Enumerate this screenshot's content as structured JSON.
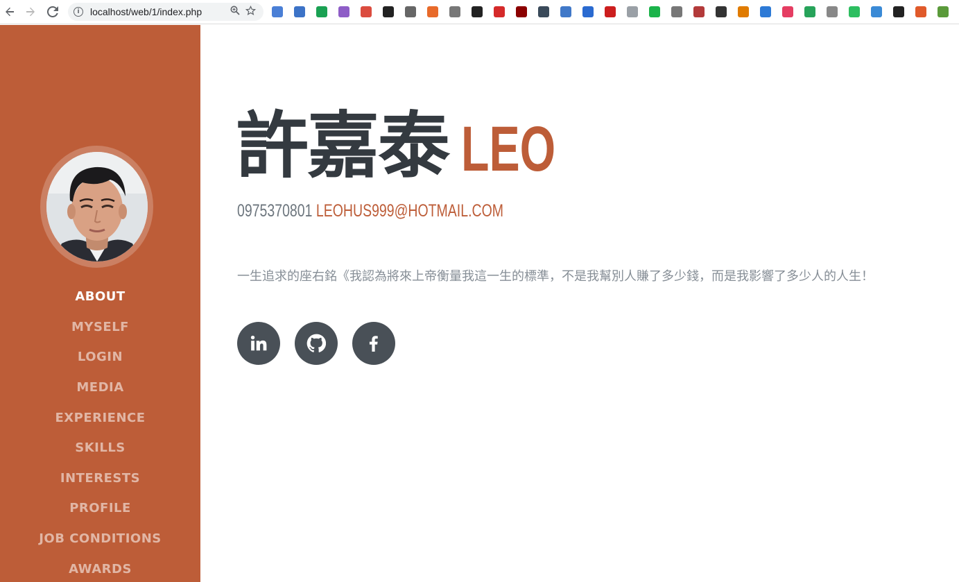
{
  "browser": {
    "url": "localhost/web/1/index.php",
    "extensions": [
      {
        "icon": "translate-icon",
        "color": "#4a7fd6"
      },
      {
        "icon": "mail-icon",
        "color": "#3c73c7"
      },
      {
        "icon": "d-badge-icon",
        "color": "#1aa153"
      },
      {
        "icon": "feather-icon",
        "color": "#8e5dc7"
      },
      {
        "icon": "todoist-icon",
        "color": "#db4c3f"
      },
      {
        "icon": "play-icon",
        "color": "#222222"
      },
      {
        "icon": "circle-icon",
        "color": "#666666"
      },
      {
        "icon": "music-icon",
        "color": "#e86a2a"
      },
      {
        "icon": "e-icon",
        "color": "#777777"
      },
      {
        "icon": "fish-icon",
        "color": "#222222"
      },
      {
        "icon": "hand-icon",
        "color": "#d52a2a"
      },
      {
        "icon": "ublock-icon",
        "color": "#8b0000"
      },
      {
        "icon": "e-dark-icon",
        "color": "#3a4a5a"
      },
      {
        "icon": "new-icon",
        "color": "#4078c8"
      },
      {
        "icon": "new-badge-icon",
        "color": "#2a6ad0"
      },
      {
        "icon": "adblock-icon",
        "color": "#cc1e1e"
      },
      {
        "icon": "dropbox-icon",
        "color": "#9aa0a6"
      },
      {
        "icon": "share-icon",
        "color": "#1bb34a"
      },
      {
        "icon": "chat-icon",
        "color": "#777777"
      },
      {
        "icon": "pdf-icon",
        "color": "#b33a3a"
      },
      {
        "icon": "brush-icon",
        "color": "#333333"
      },
      {
        "icon": "scissors-icon",
        "color": "#e07b00"
      },
      {
        "icon": "triangle-icon",
        "color": "#2d7ad6"
      },
      {
        "icon": "spiral-icon",
        "color": "#e53d62"
      },
      {
        "icon": "diamond-icon",
        "color": "#27a35a"
      },
      {
        "icon": "globe-icon",
        "color": "#888888"
      },
      {
        "icon": "evernote-icon",
        "color": "#2dbe60"
      },
      {
        "icon": "rainbow-icon",
        "color": "#3a8ad6"
      },
      {
        "icon": "ninja-icon",
        "color": "#222222"
      },
      {
        "icon": "lighthouse-icon",
        "color": "#e05a2a"
      },
      {
        "icon": "puzzle-icon",
        "color": "#5a9a3a"
      }
    ]
  },
  "sidebar": {
    "items": [
      {
        "label": "ABOUT",
        "active": true
      },
      {
        "label": "MYSELF",
        "active": false
      },
      {
        "label": "LOGIN",
        "active": false
      },
      {
        "label": "MEDIA",
        "active": false
      },
      {
        "label": "EXPERIENCE",
        "active": false
      },
      {
        "label": "SKILLS",
        "active": false
      },
      {
        "label": "INTERESTS",
        "active": false
      },
      {
        "label": "PROFILE",
        "active": false
      },
      {
        "label": "JOB CONDITIONS",
        "active": false
      },
      {
        "label": "AWARDS",
        "active": false
      }
    ]
  },
  "main": {
    "name_cn": "許嘉泰",
    "name_en": "LEO",
    "phone": "0975370801",
    "email": "LEOHUS999@HOTMAIL.COM",
    "motto": "一生追求的座右銘《我認為將來上帝衡量我這一生的標準，不是我幫別人賺了多少錢，而是我影響了多少人的人生！",
    "socials": [
      {
        "icon": "linkedin-icon"
      },
      {
        "icon": "github-icon"
      },
      {
        "icon": "facebook-icon"
      }
    ]
  },
  "colors": {
    "accent": "#bd5d38",
    "heading": "#343a40",
    "muted": "#868e96",
    "social_bg": "#495057"
  }
}
